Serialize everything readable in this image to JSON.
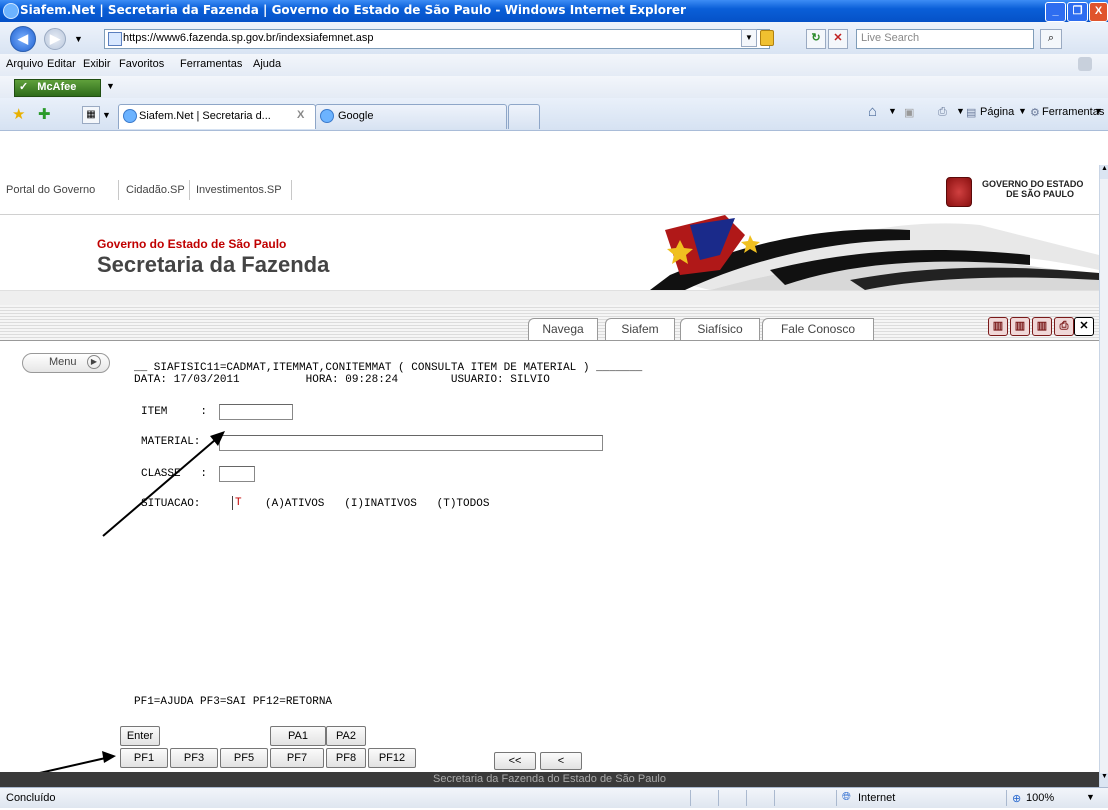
{
  "window": {
    "title": "Siafem.Net | Secretaria da Fazenda | Governo do Estado de São Paulo - Windows Internet Explorer"
  },
  "address": {
    "url": "https://www6.fazenda.sp.gov.br/indexsiafemnet.asp",
    "search_placeholder": "Live Search"
  },
  "menubar": [
    "Arquivo",
    "Editar",
    "Exibir",
    "Favoritos",
    "Ferramentas",
    "Ajuda"
  ],
  "mcafee": "McAfee",
  "tabs": [
    {
      "label": "Siafem.Net | Secretaria d...",
      "close": "X"
    },
    {
      "label": "Google"
    }
  ],
  "commandbar": {
    "pagina": "Página",
    "ferramentas": "Ferramentas"
  },
  "portal": {
    "links": [
      "Portal do Governo",
      "Cidadão.SP",
      "Investimentos.SP"
    ],
    "logo_text": "GOVERNO DO ESTADO DE SÃO PAULO",
    "logo_line1": "GOVERNO DO ESTADO",
    "logo_line2": "DE SÃO PAULO"
  },
  "header": {
    "subtitle": "Governo do Estado de São Paulo",
    "title": "Secretaria da Fazenda"
  },
  "nav_tabs": [
    "Navega",
    "Siafem",
    "Siafísico",
    "Fale Conosco"
  ],
  "menu_button": "Menu",
  "screen": {
    "title_line": "__ SIAFISIC11=CADMAT,ITEMMAT,CONITEMMAT ( CONSULTA ITEM DE MATERIAL ) _______",
    "date_line": "DATA: 17/03/2011          HORA: 09:28:24        USUARIO: SILVIO",
    "item_label": "ITEM     :",
    "material_label": "MATERIAL:",
    "classe_label": "CLASSE   :",
    "situacao_label": "SITUACAO:",
    "situacao_value": "T",
    "situacao_options": "(A)ATIVOS   (I)INATIVOS   (T)TODOS",
    "pf_line": "PF1=AJUDA PF3=SAI PF12=RETORNA"
  },
  "keys_row1": [
    "Enter",
    "PA1",
    "PA2"
  ],
  "keys_row2": [
    "PF1",
    "PF3",
    "PF5",
    "PF7",
    "PF8",
    "PF12"
  ],
  "pager": [
    "<<",
    "<"
  ],
  "footer": "Secretaria da Fazenda do Estado de São Paulo",
  "status": {
    "text": "Concluído",
    "zone": "Internet",
    "zoom": "100%"
  }
}
